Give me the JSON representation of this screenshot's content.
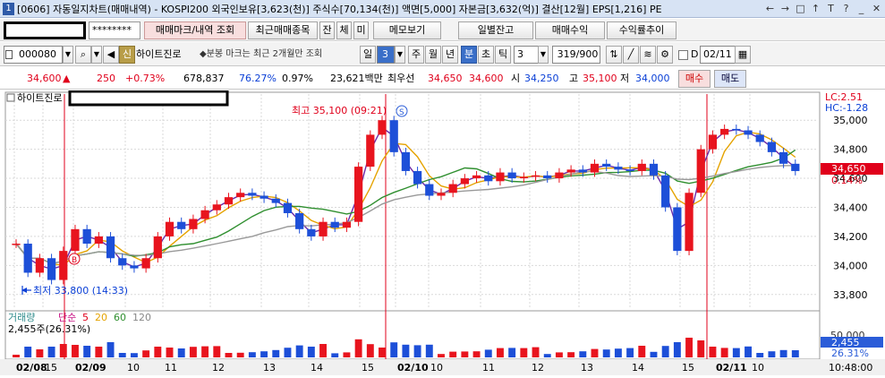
{
  "titlebar": {
    "num": "1",
    "text": "[0606] 자동일지차트(매매내역) - KOSPI200 외국인보유[3,623(천)] 주식수[70,134(천)] 액면[5,000] 자본금[3,632(억)] 결산[12월] EPS[1,216] PE",
    "icons": [
      "←",
      "→",
      "□",
      "↑",
      "T",
      "?",
      "_",
      "✕"
    ]
  },
  "toolbar1": {
    "account_masked": "********",
    "btn_trade_mark": "매매마크/내역 조회",
    "btn_recent_trades": "최근매매종목",
    "btn_jan": "잔",
    "btn_che": "체",
    "btn_mi": "미",
    "btn_memo": "메모보기",
    "btn_daily_balance": "일별잔고",
    "btn_trade_profit": "매매수익",
    "btn_profit_trend": "수익률추이"
  },
  "toolbar2": {
    "stock_code": "000080",
    "credit_badge": "신",
    "stock_name": "하이트진로",
    "note": "◆분봉 마크는 최근 2개월만 조회",
    "period_il": "일",
    "period_value": "3",
    "period_ju": "주",
    "period_wol": "월",
    "period_nyeon": "년",
    "period_bun": "분",
    "period_cho": "초",
    "period_tik": "틱",
    "tick_value": "3",
    "count": "319/900",
    "d_label": "D",
    "date": "02/11"
  },
  "quote": {
    "price": "34,600",
    "arrow": "▲",
    "change": "250",
    "change_pct": "+0.73%",
    "volume": "678,837",
    "ratio1": "76.27%",
    "ratio2": "0.97%",
    "amount": "23,621백만",
    "best_label": "최우선",
    "best_ask": "34,650",
    "best_bid": "34,600",
    "open_label": "시",
    "open": "34,250",
    "high_label": "고",
    "high": "35,100",
    "low_label": "저",
    "low": "34,000",
    "buy_btn": "매수",
    "sell_btn": "매도"
  },
  "chart": {
    "stock_label": "하이트진로",
    "max_label": "최고 35,100 (09:21)",
    "min_label": "최저 33,800 (14:33)",
    "lc": "LC:2.51",
    "hc": "HC:-1.28",
    "current_price": "34,650",
    "current_pct": "0.14%",
    "marker_s": "S",
    "marker_b": "B",
    "volume_legend": {
      "title": "거래량",
      "simple": "단순",
      "ma5": "5",
      "ma20": "20",
      "ma60": "60",
      "ma120": "120",
      "value": "2,455주(26.31%)"
    },
    "vol_axis": [
      "50,000"
    ],
    "vol_current": "2,455",
    "vol_pct": "26.31%",
    "time_right": "10:48:00"
  },
  "chart_data": {
    "type": "candlestick",
    "y_ticks": [
      "35,000",
      "34,800",
      "34,600",
      "34,400",
      "34,200",
      "34,000",
      "33,800"
    ],
    "y_tick_values": [
      35000,
      34800,
      34600,
      34400,
      34200,
      34000,
      33800
    ],
    "ylim": [
      33700,
      35180
    ],
    "x_ticks": [
      "02/08",
      "15",
      "02/09",
      "10",
      "11",
      "12",
      "13",
      "14",
      "15",
      "02/10",
      "10",
      "11",
      "12",
      "13",
      "14",
      "15",
      "02/11",
      "10"
    ],
    "max": 35100,
    "min": 33800,
    "current": 34650,
    "colors": {
      "up": "#e8141e",
      "down": "#1d4fd8",
      "ma5": "#e5a300",
      "ma20": "#6b2aa8",
      "ma60": "#2f8f2f",
      "ma120": "#999999",
      "grid": "#d9d9d9"
    },
    "candles": [
      34150,
      33950,
      34050,
      33900,
      34100,
      34250,
      34150,
      34200,
      34050,
      34000,
      33980,
      34050,
      34200,
      34300,
      34250,
      34320,
      34380,
      34420,
      34470,
      34500,
      34480,
      34460,
      34430,
      34360,
      34250,
      34200,
      34300,
      34260,
      34300,
      34680,
      34900,
      35000,
      34780,
      34650,
      34560,
      34480,
      34500,
      34560,
      34600,
      34620,
      34580,
      34640,
      34600,
      34610,
      34620,
      34600,
      34640,
      34660,
      34640,
      34700,
      34680,
      34660,
      34650,
      34700,
      34620,
      34400,
      34100,
      34500,
      34800,
      34900,
      34940,
      34930,
      34900,
      34850,
      34780,
      34700,
      34650
    ]
  }
}
